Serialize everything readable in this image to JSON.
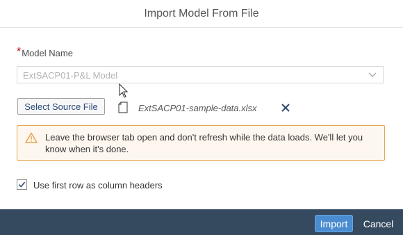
{
  "dialog": {
    "title": "Import Model From File"
  },
  "model_name": {
    "required_marker": "*",
    "label": "Model Name",
    "value": "ExtSACP01-P&L Model"
  },
  "source": {
    "button_label": "Select Source File",
    "file_name": "ExtSACP01-sample-data.xlsx"
  },
  "warning": {
    "text": "Leave the browser tab open and don't refresh while the data loads. We'll let you know when it's done.",
    "color": "#e9a44c"
  },
  "options": {
    "first_row_headers_label": "Use first row as column headers",
    "first_row_headers_checked": true
  },
  "footer": {
    "import_label": "Import",
    "cancel_label": "Cancel",
    "background": "#354a5f",
    "import_color": "#4a8cd0"
  },
  "icons": [
    "chevron-down-icon",
    "file-icon",
    "close-icon",
    "warning-icon",
    "checkmark-icon",
    "mouse-cursor-icon"
  ]
}
